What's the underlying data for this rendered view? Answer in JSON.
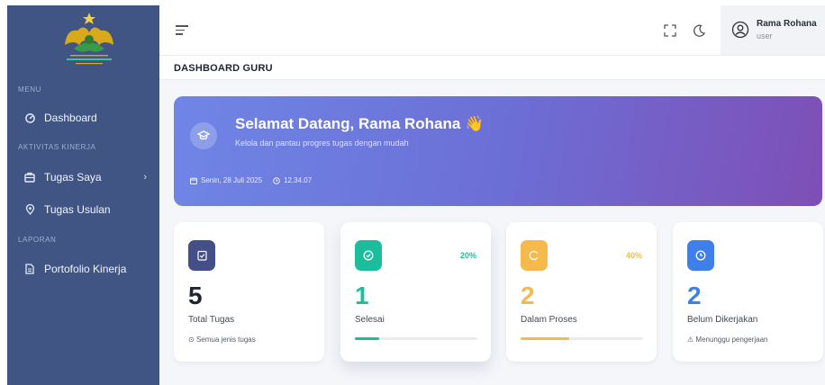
{
  "sidebar": {
    "sections": [
      {
        "header": "MENU",
        "items": [
          {
            "label": "Dashboard",
            "icon": "dashboard-icon"
          }
        ]
      },
      {
        "header": "AKTIVITAS KINERJA",
        "items": [
          {
            "label": "Tugas Saya",
            "icon": "briefcase-icon",
            "has_submenu": true
          },
          {
            "label": "Tugas Usulan",
            "icon": "location-pin-icon"
          }
        ]
      },
      {
        "header": "LAPORAN",
        "items": [
          {
            "label": "Portofolio Kinerja",
            "icon": "document-icon"
          }
        ]
      }
    ]
  },
  "topbar": {
    "icons": [
      "menu-icon",
      "fullscreen-icon",
      "moon-icon"
    ],
    "user": {
      "name": "Rama Rohana",
      "role": "user"
    }
  },
  "page": {
    "title": "DASHBOARD GURU"
  },
  "hero": {
    "title": "Selamat Datang, Rama Rohana 👋",
    "subtitle": "Kelola dan pantau progres tugas dengan mudah",
    "date": "Senin, 28 Juli 2025",
    "time": "12.34.07"
  },
  "cards": [
    {
      "value": "5",
      "label": "Total Tugas",
      "note": "Semua jenis tugas",
      "icon": "clipboard-check-icon",
      "color": "#434f86"
    },
    {
      "value": "1",
      "label": "Selesai",
      "percent": "20%",
      "progress": 0.2,
      "icon": "check-circle-icon",
      "color": "#1cbd9c"
    },
    {
      "value": "2",
      "label": "Dalam Proses",
      "percent": "40%",
      "progress": 0.4,
      "icon": "spinner-icon",
      "color": "#f6b94b"
    },
    {
      "value": "2",
      "label": "Belum Dikerjakan",
      "note": "Menunggu pengerjaan",
      "icon": "clock-icon",
      "color": "#3f7fea"
    }
  ],
  "colors": {
    "sidebar_bg": "#415585",
    "hero_start": "#6f86e6",
    "hero_end": "#7e4fb6",
    "text_dark": "#1f2430"
  }
}
